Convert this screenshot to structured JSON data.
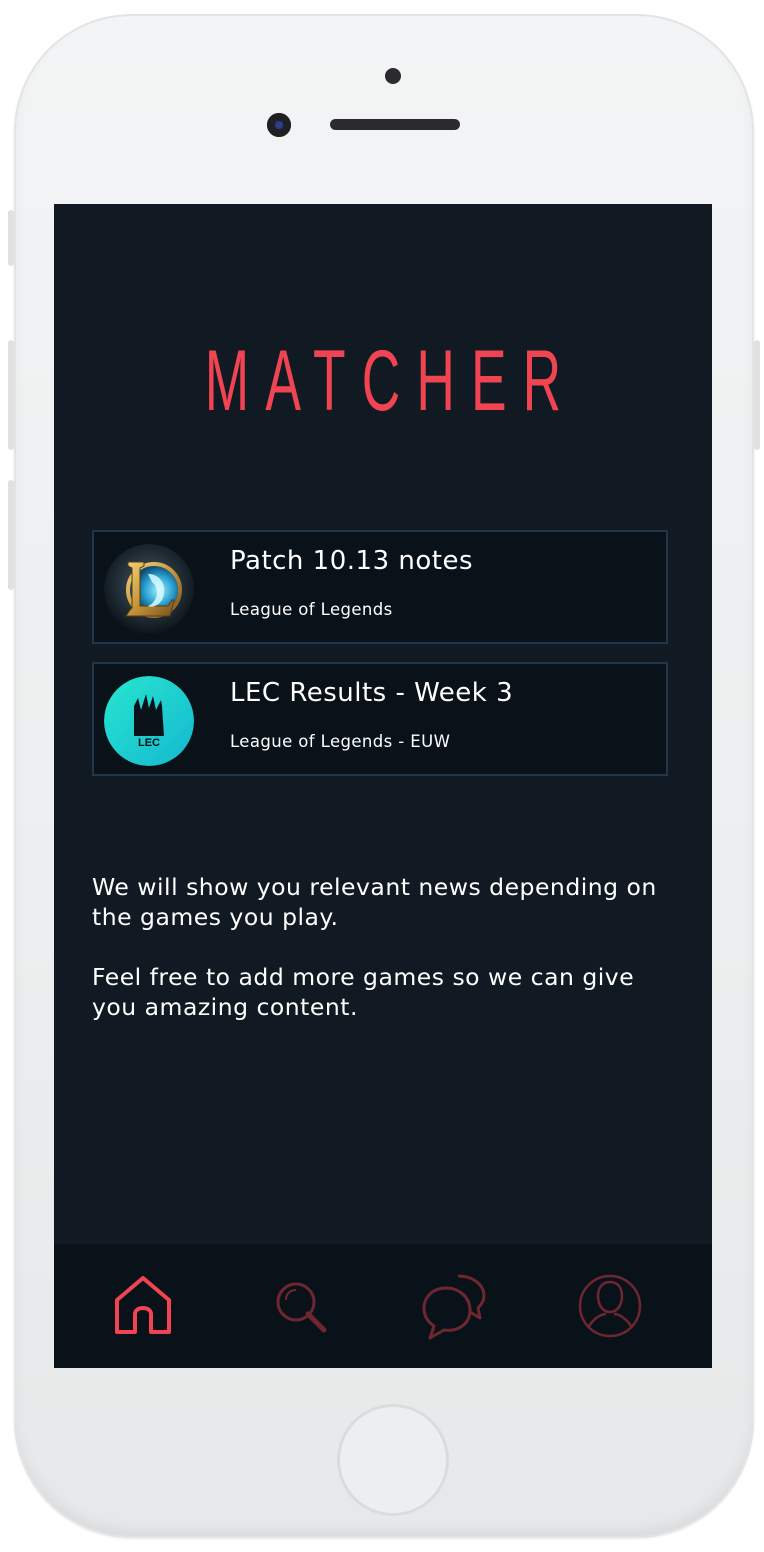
{
  "app": {
    "title": "MATCHER",
    "accent_color": "#f04452",
    "inactive_icon_color": "#6e2730",
    "background_color": "#111a23",
    "card_background": "#0a1219",
    "card_border": "#22364a"
  },
  "news": [
    {
      "title": "Patch 10.13 notes",
      "subtitle": "League of Legends",
      "icon": "league-of-legends-logo"
    },
    {
      "title": "LEC Results - Week 3",
      "subtitle": "League of Legends - EUW",
      "icon": "lec-logo"
    }
  ],
  "info": {
    "paragraph_1": "We will show you relevant news depending on the games you play.",
    "paragraph_2": "Feel free to add more games so we can give you amazing content."
  },
  "tabs": [
    {
      "name": "home",
      "icon": "home-icon",
      "active": true
    },
    {
      "name": "search",
      "icon": "search-icon",
      "active": false
    },
    {
      "name": "chat",
      "icon": "chat-bubbles-icon",
      "active": false
    },
    {
      "name": "profile",
      "icon": "user-icon",
      "active": false
    }
  ]
}
